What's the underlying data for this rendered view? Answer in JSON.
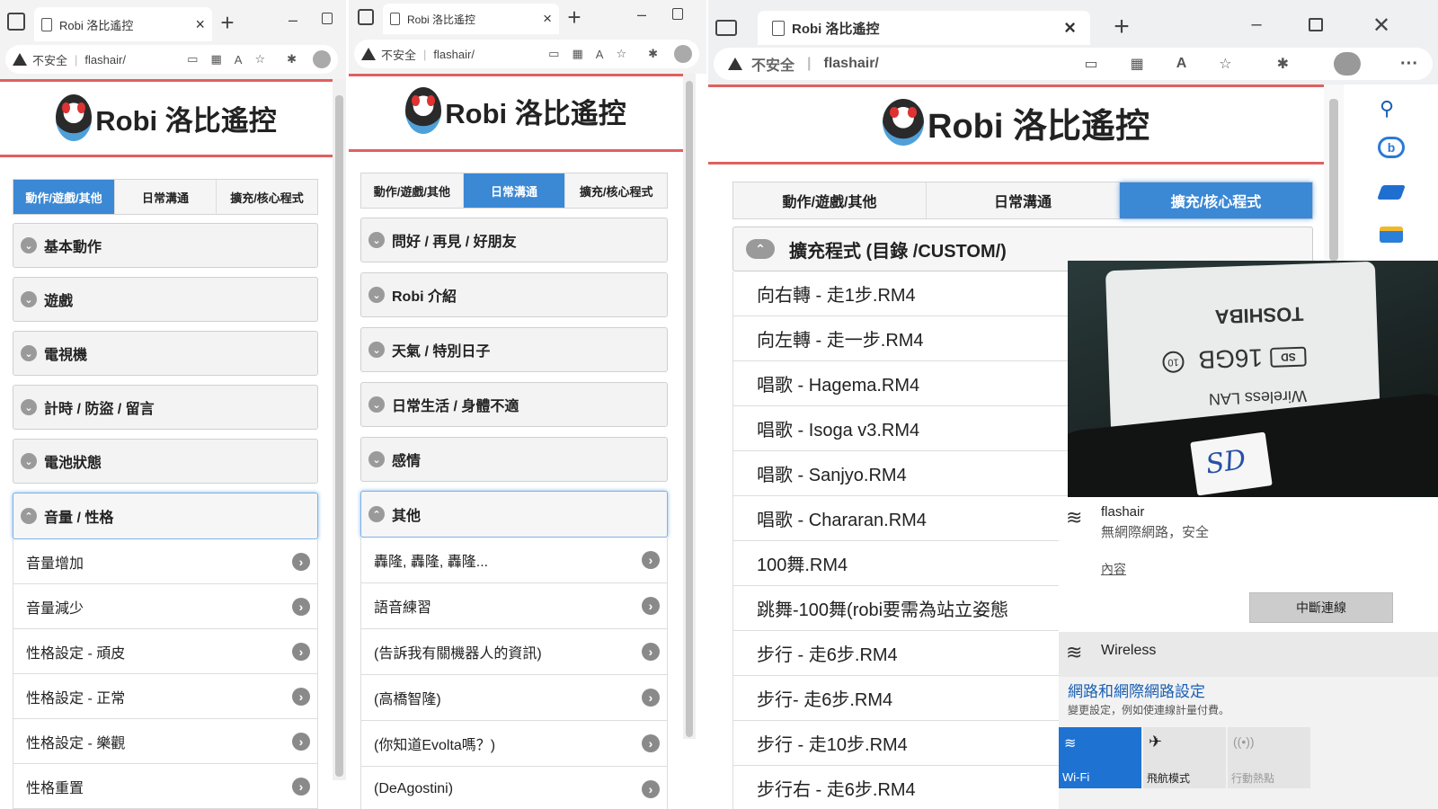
{
  "browser": {
    "tab_title": "Robi 洛比遙控",
    "close_symbol": "×",
    "new_tab_symbol": "+",
    "security_label": "不安全",
    "url": "flashair/"
  },
  "site": {
    "logo_text": "Robi 洛比遙控",
    "tabs": [
      "動作/遊戲/其他",
      "日常溝通",
      "擴充/核心程式"
    ]
  },
  "panel1": {
    "sections": [
      "基本動作",
      "遊戲",
      "電視機",
      "計時 / 防盜 / 留言",
      "電池狀態"
    ],
    "open_section": "音量 / 性格",
    "items": [
      "音量增加",
      "音量減少",
      "性格設定 - 頑皮",
      "性格設定 - 正常",
      "性格設定 - 樂觀",
      "性格重置"
    ]
  },
  "panel2": {
    "sections": [
      "問好 / 再見 / 好朋友",
      "Robi 介紹",
      "天氣 / 特別日子",
      "日常生活 / 身體不適",
      "感情"
    ],
    "open_section": "其他",
    "items": [
      "轟隆, 轟隆, 轟隆...",
      "語音練習",
      "(告訴我有關機器人的資訊)",
      "(高橋智隆)",
      "(你知道Evolta嗎？)",
      "(DeAgostini)"
    ]
  },
  "panel3": {
    "open_section": "擴充程式 (目錄 /CUSTOM/)",
    "items": [
      "向右轉 - 走1步.RM4",
      "向左轉 - 走一步.RM4",
      "唱歌 - Hagema.RM4",
      "唱歌 - Isoga v3.RM4",
      "唱歌 - Sanjyo.RM4",
      "唱歌 - Chararan.RM4",
      "100舞.RM4",
      "跳舞-100舞(robi要需為站立姿態",
      "步行 - 走6步.RM4",
      "步行- 走6步.RM4",
      "步行 - 走10步.RM4",
      "步行右 - 走6步.RM4"
    ]
  },
  "photo": {
    "brand": "TOSHIBA",
    "capacity": "16GB",
    "sd_logo": "SD",
    "class": "10",
    "label": "Wireless LAN",
    "sticker": "SD"
  },
  "wifi_panel": {
    "network_name": "flashair",
    "network_status": "無網際網路，安全",
    "properties_link": "內容",
    "disconnect_button": "中斷連線",
    "other_network": "Wireless",
    "settings_link": "網路和網際網路設定",
    "settings_desc": "變更設定，例如使連線計量付費。",
    "quick_actions": [
      "Wi-Fi",
      "飛航模式",
      "行動熱點"
    ]
  },
  "colors": {
    "accent_blue": "#3b88d4",
    "logo_red_line": "#e06060",
    "wifi_tile_blue": "#1e73d2",
    "link_blue": "#1a5fb4"
  }
}
